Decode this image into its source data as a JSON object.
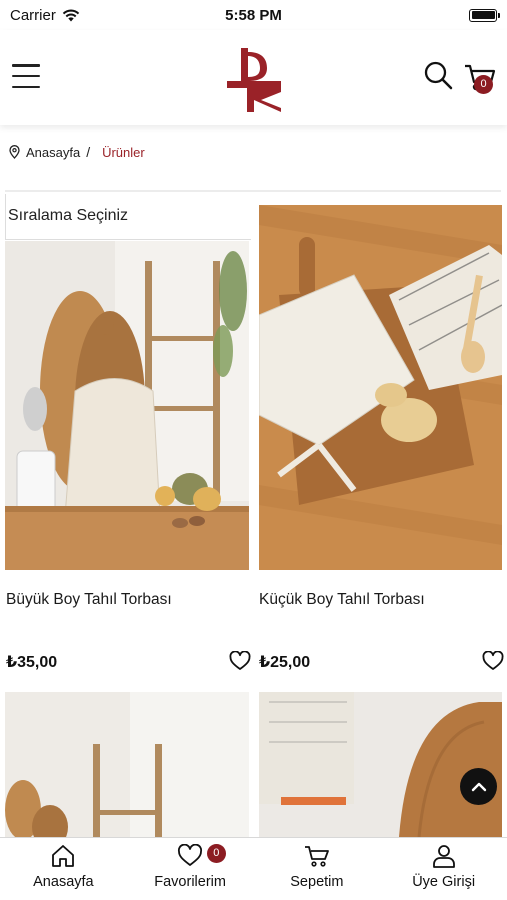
{
  "status_bar": {
    "carrier": "Carrier",
    "time": "5:58 PM"
  },
  "header": {
    "cart_count": "0",
    "brand_color": "#9a2228"
  },
  "breadcrumb": {
    "home": "Anasayfa",
    "separator": "/",
    "current": "Ürünler"
  },
  "sort": {
    "label": "Sıralama Seçiniz"
  },
  "products": [
    {
      "name": "Büyük Boy Tahıl Torbası",
      "price": "₺35,00"
    },
    {
      "name": "Küçük Boy Tahıl Torbası",
      "price": "₺25,00"
    }
  ],
  "tab_bar": {
    "items": [
      {
        "label": "Anasayfa",
        "icon": "home-icon"
      },
      {
        "label": "Favorilerim",
        "icon": "heart-icon",
        "badge": "0"
      },
      {
        "label": "Sepetim",
        "icon": "cart-icon"
      },
      {
        "label": "Üye Girişi",
        "icon": "user-icon"
      }
    ]
  }
}
